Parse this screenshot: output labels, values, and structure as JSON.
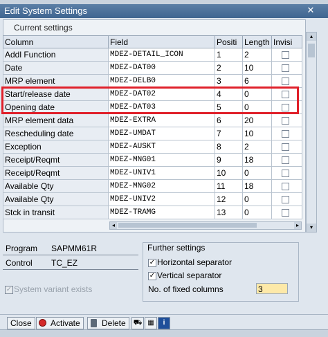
{
  "window": {
    "title": "Edit System Settings"
  },
  "current_settings": {
    "title": "Current settings",
    "headers": [
      "Column",
      "Field",
      "Positi",
      "Length",
      "Invisi"
    ],
    "rows": [
      [
        "Addl Function",
        "MDEZ-DETAIL_ICON",
        "1",
        "2"
      ],
      [
        "Date",
        "MDEZ-DAT00",
        "2",
        "10"
      ],
      [
        "MRP element",
        "MDEZ-DELB0",
        "3",
        "6"
      ],
      [
        "Start/release date",
        "MDEZ-DAT02",
        "4",
        "0"
      ],
      [
        "Opening date",
        "MDEZ-DAT03",
        "5",
        "0"
      ],
      [
        "MRP element data",
        "MDEZ-EXTRA",
        "6",
        "20"
      ],
      [
        "Rescheduling date",
        "MDEZ-UMDAT",
        "7",
        "10"
      ],
      [
        "Exception",
        "MDEZ-AUSKT",
        "8",
        "2"
      ],
      [
        "Receipt/Reqmt",
        "MDEZ-MNG01",
        "9",
        "18"
      ],
      [
        "Receipt/Reqmt",
        "MDEZ-UNIV1",
        "10",
        "0"
      ],
      [
        "Available Qty",
        "MDEZ-MNG02",
        "11",
        "18"
      ],
      [
        "Available Qty",
        "MDEZ-UNIV2",
        "12",
        "0"
      ],
      [
        "Stck in transit",
        "MDEZ-TRAMG",
        "13",
        "0"
      ]
    ]
  },
  "program": {
    "label": "Program",
    "value": "SAPMM61R"
  },
  "control": {
    "label": "Control",
    "value": "TC_EZ"
  },
  "system_variant": {
    "label": "System variant exists"
  },
  "further_settings": {
    "title": "Further settings",
    "horizontal_separator": "Horizontal separator",
    "vertical_separator": "Vertical separator",
    "fixed_columns_label": "No. of fixed columns",
    "fixed_columns_value": "3"
  },
  "buttons": {
    "close": "Close",
    "activate": "Activate",
    "delete": "Delete"
  },
  "colors": {
    "highlight": "#e0202a",
    "title_bar": "#3f6590",
    "input_bg": "#fde9a8"
  }
}
